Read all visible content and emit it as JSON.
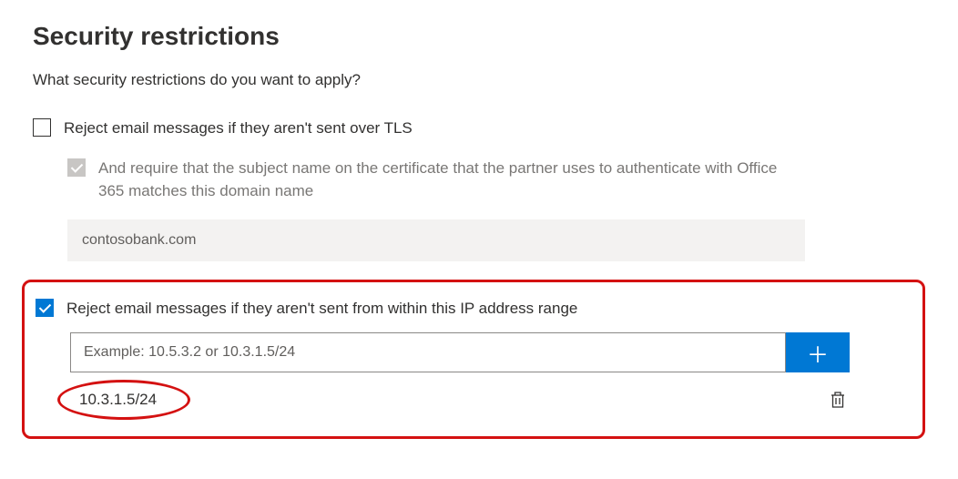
{
  "page": {
    "title": "Security restrictions",
    "subtitle": "What security restrictions do you want to apply?"
  },
  "tls": {
    "checked": false,
    "label": "Reject email messages if they aren't sent over TLS",
    "sub": {
      "checked": true,
      "disabled": true,
      "label": "And require that the subject name on the certificate that the partner uses to authenticate with Office 365 matches this domain name",
      "domain_value": "contosobank.com"
    }
  },
  "ip": {
    "checked": true,
    "label": "Reject email messages if they aren't sent from within this IP address range",
    "input_placeholder": "Example: 10.5.3.2 or 10.3.1.5/24",
    "input_value": "",
    "entries": [
      "10.3.1.5/24"
    ]
  }
}
